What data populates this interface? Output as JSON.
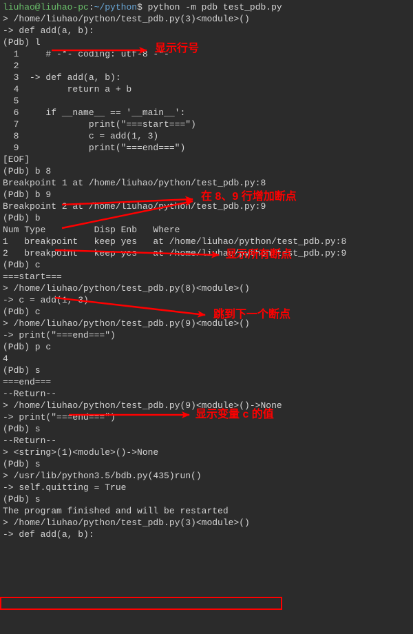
{
  "prompt": {
    "user": "liuhao@liuhao-pc",
    "sep1": ":",
    "path": "~/python",
    "dollar": "$ ",
    "cmd": "python -m pdb test_pdb.py"
  },
  "lines": {
    "l01": "> /home/liuhao/python/test_pdb.py(3)<module>()",
    "l02": "-> def add(a, b):",
    "l03": "(Pdb) l",
    "l04": "  1     # -*- coding: utf-8 -*-",
    "l05": "  2",
    "l06": "  3  -> def add(a, b):",
    "l07": "  4         return a + b",
    "l08": "  5",
    "l09": "  6     if __name__ == '__main__':",
    "l10": "  7             print(\"===start===\")",
    "l11": "  8             c = add(1, 3)",
    "l12": "  9             print(\"===end===\")",
    "l13": "[EOF]",
    "l14": "(Pdb) b 8",
    "l15": "Breakpoint 1 at /home/liuhao/python/test_pdb.py:8",
    "l16": "(Pdb) b 9",
    "l17": "Breakpoint 2 at /home/liuhao/python/test_pdb.py:9",
    "l18": "(Pdb) b",
    "l19": "Num Type         Disp Enb   Where",
    "l20": "1   breakpoint   keep yes   at /home/liuhao/python/test_pdb.py:8",
    "l21": "2   breakpoint   keep yes   at /home/liuhao/python/test_pdb.py:9",
    "l22": "(Pdb) c",
    "l23": "===start===",
    "l24": "> /home/liuhao/python/test_pdb.py(8)<module>()",
    "l25": "-> c = add(1, 3)",
    "l26": "(Pdb) c",
    "l27": "> /home/liuhao/python/test_pdb.py(9)<module>()",
    "l28": "-> print(\"===end===\")",
    "l29": "(Pdb) p c",
    "l30": "4",
    "l31": "(Pdb) s",
    "l32": "===end===",
    "l33": "--Return--",
    "l34": "> /home/liuhao/python/test_pdb.py(9)<module>()->None",
    "l35": "-> print(\"===end===\")",
    "l36": "(Pdb) s",
    "l37": "--Return--",
    "l38": "> <string>(1)<module>()->None",
    "l39": "(Pdb) s",
    "l40": "> /usr/lib/python3.5/bdb.py(435)run()",
    "l41": "-> self.quitting = True",
    "l42": "(Pdb) s",
    "l43": "The program finished and will be restarted",
    "l44": "> /home/liuhao/python/test_pdb.py(3)<module>()",
    "l45": "-> def add(a, b):"
  },
  "annotations": {
    "a1": "显示行号",
    "a2": "在 8、9 行增加断点",
    "a3": "显示所有断点",
    "a4": "跳到下一个断点",
    "a5": "显示变量 c 的值"
  }
}
